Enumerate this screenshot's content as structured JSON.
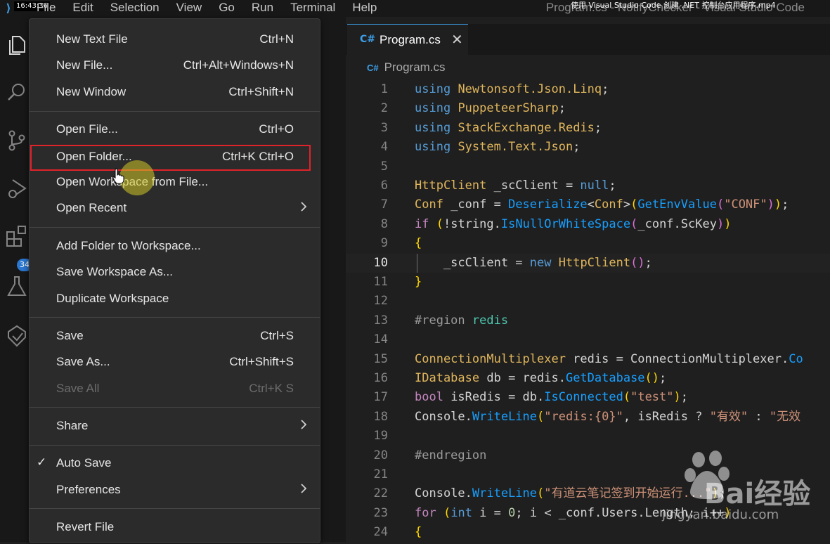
{
  "titlebar": {
    "time": "16:43:36",
    "menus": [
      "File",
      "Edit",
      "Selection",
      "View",
      "Go",
      "Run",
      "Terminal",
      "Help"
    ],
    "window_title": "Program.cs - NotifyChecker - Visual Studio Code",
    "video_overlay": "使用 Visual Studio Code 创建 .NET 控制台应用程序.mp4"
  },
  "activity_bar": {
    "icons": [
      "explorer-icon",
      "search-icon",
      "source-control-icon",
      "run-debug-icon",
      "extensions-icon",
      "testing-icon",
      "remote-icon"
    ],
    "extensions_badge": "34"
  },
  "file_menu": {
    "items": [
      {
        "label": "New Text File",
        "shortcut": "Ctrl+N"
      },
      {
        "label": "New File...",
        "shortcut": "Ctrl+Alt+Windows+N"
      },
      {
        "label": "New Window",
        "shortcut": "Ctrl+Shift+N"
      },
      {
        "label": "Open File...",
        "shortcut": "Ctrl+O"
      },
      {
        "label": "Open Folder...",
        "shortcut": "Ctrl+K Ctrl+O"
      },
      {
        "label": "Open Workspace from File...",
        "shortcut": ""
      },
      {
        "label": "Open Recent",
        "shortcut": ""
      },
      {
        "label": "Add Folder to Workspace...",
        "shortcut": ""
      },
      {
        "label": "Save Workspace As...",
        "shortcut": ""
      },
      {
        "label": "Duplicate Workspace",
        "shortcut": ""
      },
      {
        "label": "Save",
        "shortcut": "Ctrl+S"
      },
      {
        "label": "Save As...",
        "shortcut": "Ctrl+Shift+S"
      },
      {
        "label": "Save All",
        "shortcut": "Ctrl+K S"
      },
      {
        "label": "Share",
        "shortcut": ""
      },
      {
        "label": "Auto Save",
        "shortcut": ""
      },
      {
        "label": "Preferences",
        "shortcut": ""
      },
      {
        "label": "Revert File",
        "shortcut": ""
      }
    ],
    "auto_save_checked": true,
    "highlighted": "Open Folder..."
  },
  "editor": {
    "tab_label": "Program.cs",
    "breadcrumb": "Program.cs",
    "current_line": 10,
    "line_numbers": [
      "1",
      "2",
      "3",
      "4",
      "5",
      "6",
      "7",
      "8",
      "9",
      "10",
      "11",
      "12",
      "13",
      "14",
      "15",
      "16",
      "17",
      "18",
      "19",
      "20",
      "21",
      "22",
      "23",
      "24"
    ],
    "code": {
      "l1": [
        "using",
        " ",
        "Newtonsoft.Json.Linq",
        ";"
      ],
      "l2": [
        "using",
        " ",
        "PuppeteerSharp",
        ";"
      ],
      "l3": [
        "using",
        " ",
        "StackExchange.Redis",
        ";"
      ],
      "l4": [
        "using",
        " ",
        "System.Text.Json",
        ";"
      ],
      "l6": [
        "HttpClient",
        " _scClient = ",
        "null",
        ";"
      ],
      "l7": [
        "Conf",
        " _conf = ",
        "Deserialize",
        "<",
        "Conf",
        ">",
        "(",
        "GetEnvValue",
        "(",
        "\"CONF\"",
        ")",
        ")",
        ";"
      ],
      "l8": [
        "if",
        " ",
        "(",
        "!string.",
        "IsNullOrWhiteSpace",
        "(",
        "_conf.ScKey",
        ")",
        ")"
      ],
      "l9": [
        "{"
      ],
      "l10": [
        "    _scClient = ",
        "new",
        " ",
        "HttpClient",
        "(",
        ")",
        ";"
      ],
      "l11": [
        "}"
      ],
      "l13": [
        "#region",
        " ",
        "redis"
      ],
      "l15": [
        "ConnectionMultiplexer",
        " redis = ConnectionMultiplexer.",
        "Co"
      ],
      "l16": [
        "IDatabase",
        " db = redis.",
        "GetDatabase",
        "(",
        ")",
        ";"
      ],
      "l17": [
        "bool",
        " isRedis = db.",
        "IsConnected",
        "(",
        "\"test\"",
        ")",
        ";"
      ],
      "l18": [
        "Console.",
        "WriteLine",
        "(",
        "\"redis:{0}\"",
        ", isRedis ? ",
        "\"有效\"",
        " : ",
        "\"无效"
      ],
      "l20": [
        "#endregion"
      ],
      "l22": [
        "Console.",
        "WriteLine",
        "(",
        "\"有道云笔记签到开始运行...\"",
        ")",
        ";"
      ],
      "l23": [
        "for",
        " ",
        "(",
        "int",
        " i = ",
        "0",
        "; i < _conf.Users.Length; i++",
        ")"
      ],
      "l24": [
        "{"
      ]
    }
  },
  "watermark": {
    "text": "Bai经验",
    "url": "jingyan.baidu.com"
  }
}
